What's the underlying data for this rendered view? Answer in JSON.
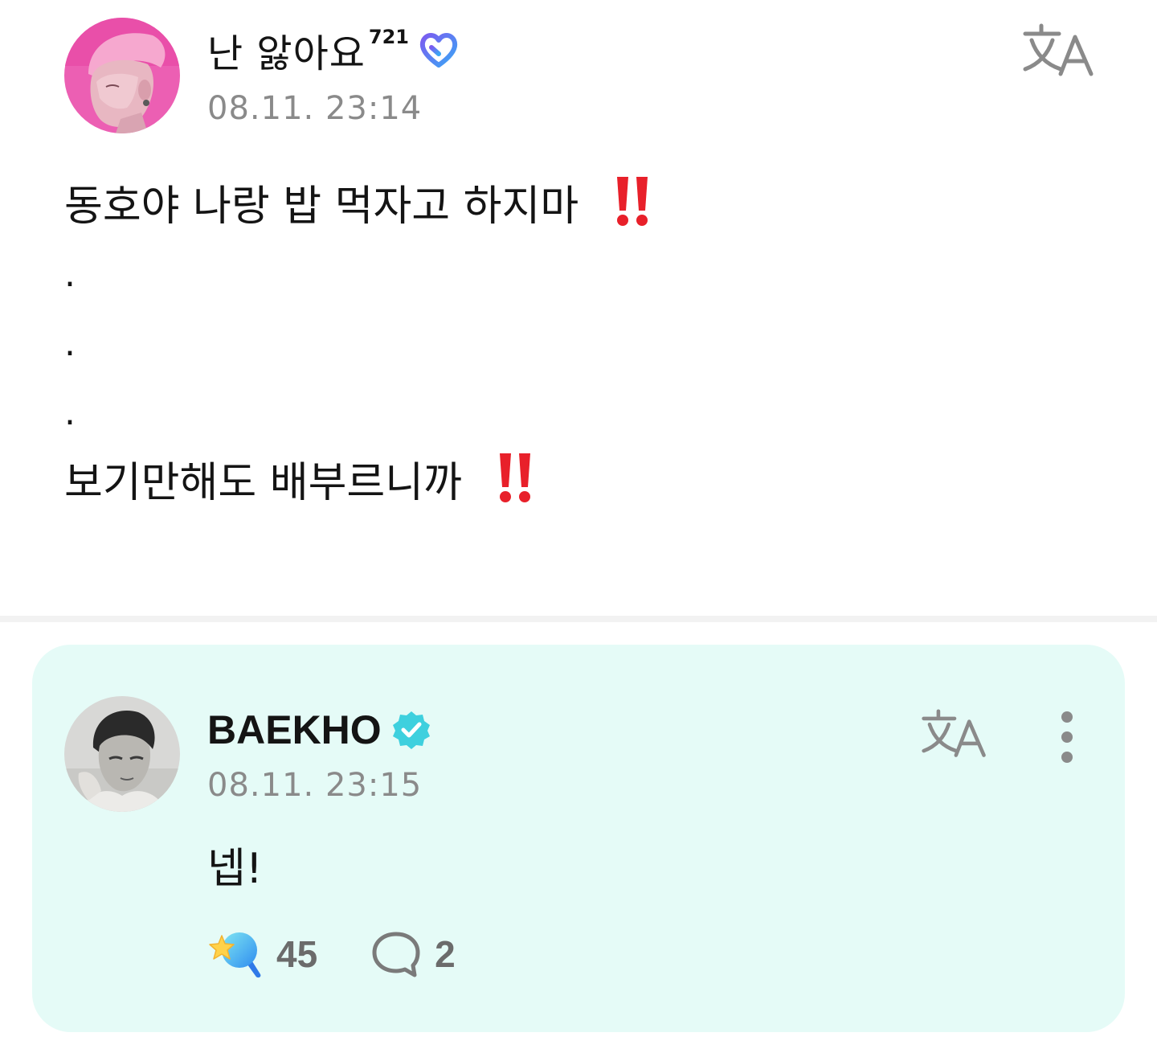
{
  "post": {
    "author": {
      "name": "난 앓아요",
      "number": "721",
      "avatar": "pink-haired-person-avatar",
      "badge": "fan-heart-badge-icon"
    },
    "timestamp": "08.11. 23:14",
    "lines": [
      "동호야 나랑 밥 먹자고 하지마",
      ".",
      ".",
      ".",
      "보기만해도 배부르니까"
    ],
    "emoji": "double-exclamation-mark"
  },
  "reply": {
    "author": {
      "name": "BAEKHO",
      "avatar": "monochrome-portrait-avatar",
      "badge": "verified-check-icon"
    },
    "timestamp": "08.11. 23:15",
    "text": "넵!",
    "likes": "45",
    "comments": "2"
  },
  "icons": {
    "translate": "translate-icon",
    "more": "more-vertical-icon",
    "like": "star-lightstick-icon",
    "comment": "speech-bubble-icon"
  },
  "colors": {
    "reply_bg": "#e5fbf7",
    "verified": "#3ed0de",
    "exclaim": "#e8202a",
    "muted": "#8a8a8a"
  }
}
